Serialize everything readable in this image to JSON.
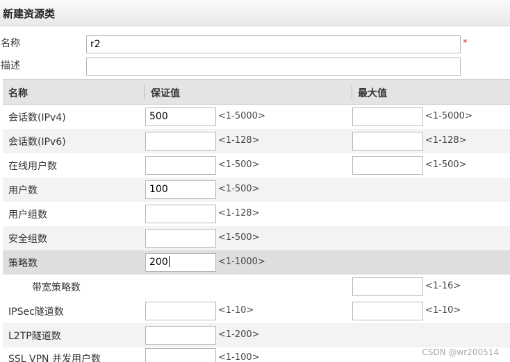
{
  "dialog": {
    "title": "新建资源类"
  },
  "form": {
    "name_label": "名称",
    "name_value": "r2",
    "required_mark": "*",
    "desc_label": "描述",
    "desc_value": ""
  },
  "table": {
    "headers": {
      "name": "名称",
      "guarantee": "保证值",
      "max": "最大值"
    },
    "rows": [
      {
        "label": "会话数(IPv4)",
        "guarantee_value": "500",
        "guarantee_range": "<1-5000>",
        "max_value": "",
        "max_range": "<1-5000>"
      },
      {
        "label": "会话数(IPv6)",
        "guarantee_value": "",
        "guarantee_range": "<1-128>",
        "max_value": "",
        "max_range": "<1-128>"
      },
      {
        "label": "在线用户数",
        "guarantee_value": "",
        "guarantee_range": "<1-500>",
        "max_value": "",
        "max_range": "<1-500>"
      },
      {
        "label": "用户数",
        "guarantee_value": "100",
        "guarantee_range": "<1-500>"
      },
      {
        "label": "用户组数",
        "guarantee_value": "",
        "guarantee_range": "<1-128>"
      },
      {
        "label": "安全组数",
        "guarantee_value": "",
        "guarantee_range": "<1-500>"
      },
      {
        "label": "策略数",
        "guarantee_value": "200",
        "guarantee_range": "<1-1000>"
      },
      {
        "label": "带宽策略数",
        "max_value": "",
        "max_range": "<1-16>"
      },
      {
        "label": "IPSec隧道数",
        "guarantee_value": "",
        "guarantee_range": "<1-10>",
        "max_value": "",
        "max_range": "<1-10>"
      },
      {
        "label": "L2TP隧道数",
        "guarantee_value": "",
        "guarantee_range": "<1-200>"
      },
      {
        "label": "SSL VPN 并发用户数",
        "guarantee_value": "",
        "guarantee_range": "<1-100>"
      }
    ]
  },
  "watermark": "CSDN @wr200514"
}
